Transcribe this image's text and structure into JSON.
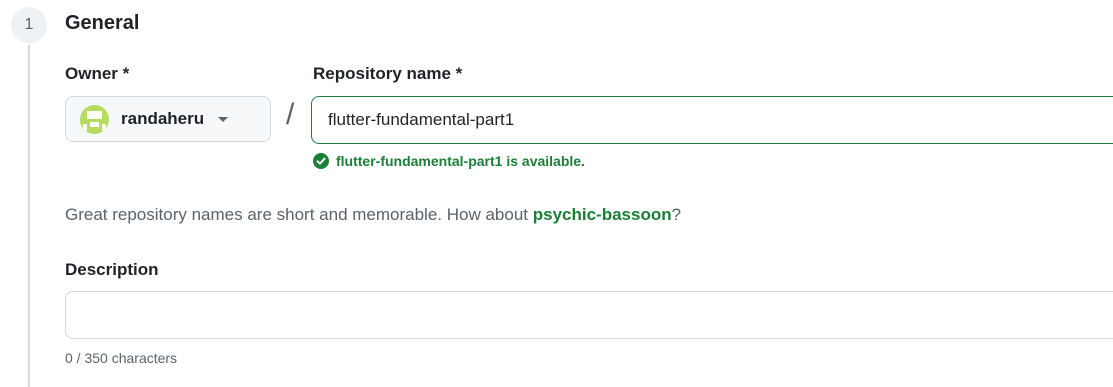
{
  "step": {
    "number": "1",
    "title": "General"
  },
  "owner": {
    "label": "Owner *",
    "selected": "randaheru",
    "avatar_color": "#b5dc5c"
  },
  "separator": "/",
  "repository": {
    "label": "Repository name *",
    "value": "flutter-fundamental-part1",
    "availability_message": "flutter-fundamental-part1 is available."
  },
  "hint": {
    "prefix": "Great repository names are short and memorable. How about ",
    "suggestion": "psychic-bassoon",
    "suffix": "?"
  },
  "description": {
    "label": "Description",
    "value": "",
    "char_count": "0 / 350 characters"
  },
  "colors": {
    "success": "#1a7f37",
    "border": "#d1d9e0",
    "muted_text": "#59636e"
  }
}
